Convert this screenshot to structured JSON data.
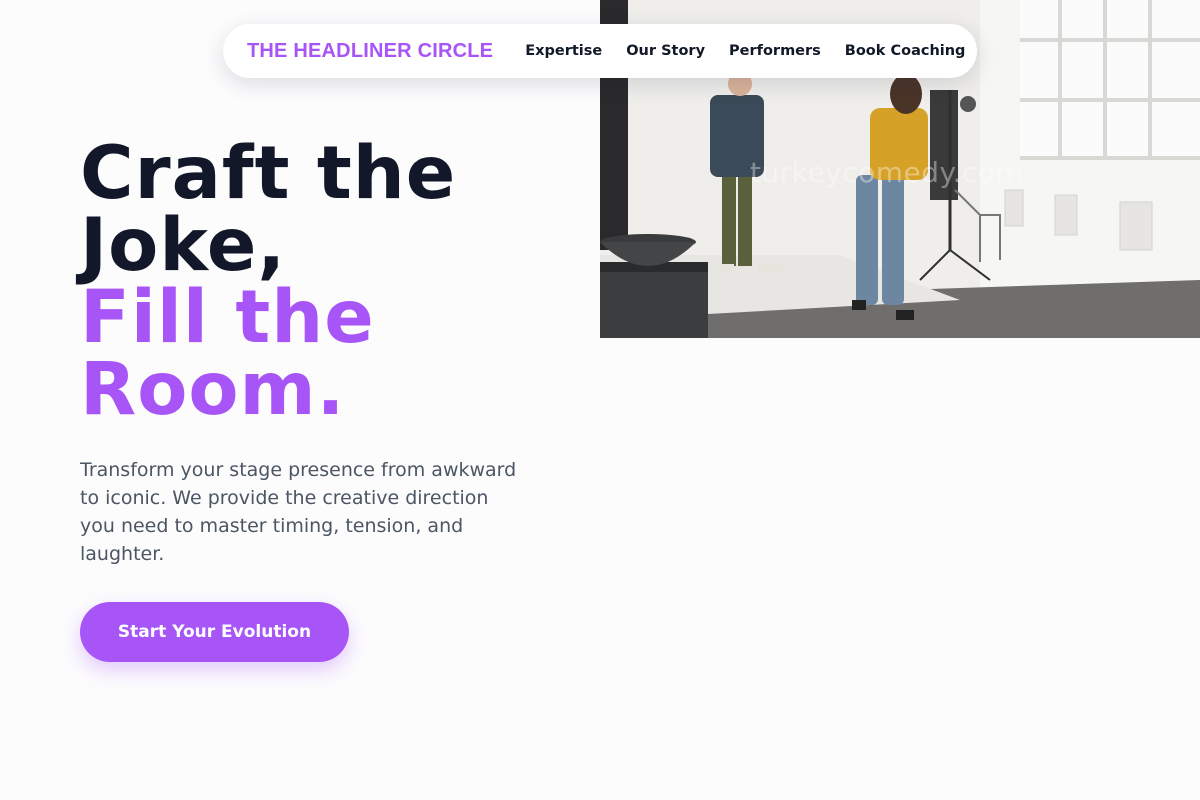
{
  "nav": {
    "brand": "THE HEADLINER CIRCLE",
    "links": [
      {
        "label": "Expertise"
      },
      {
        "label": "Our Story"
      },
      {
        "label": "Performers"
      },
      {
        "label": "Book Coaching"
      }
    ]
  },
  "hero": {
    "headline_dark_1": "Craft the",
    "headline_dark_2": "Joke,",
    "headline_accent_1": "Fill the",
    "headline_accent_2": "Room.",
    "lede": "Transform your stage presence from awkward to iconic. We provide the creative direction you need to master timing, tension, and laughter.",
    "cta_label": "Start Your Evolution"
  },
  "photo": {
    "watermark": "turkeycomedy.com"
  },
  "colors": {
    "accent": "#a855f7",
    "heading": "#121829",
    "body_text": "#4b5563",
    "background": "#fcfcfd"
  }
}
